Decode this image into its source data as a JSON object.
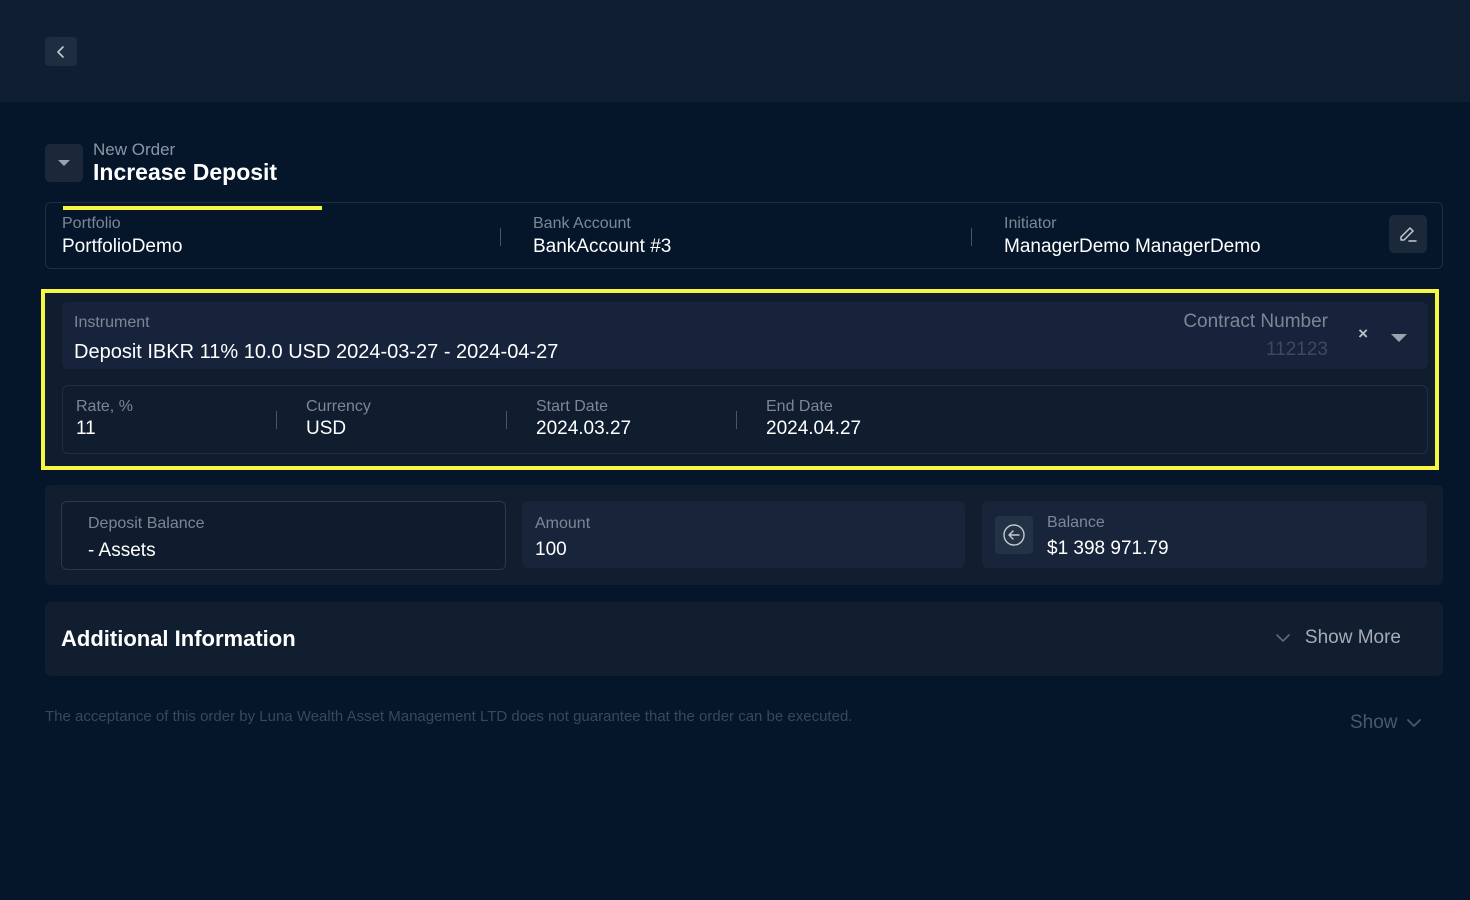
{
  "header": {
    "back_icon": "chevron-left-icon"
  },
  "order": {
    "subtitle": "New Order",
    "title": "Increase Deposit",
    "collapse_icon": "caret-down-icon"
  },
  "info": {
    "portfolio": {
      "label": "Portfolio",
      "value": "PortfolioDemo"
    },
    "bank_account": {
      "label": "Bank Account",
      "value": "BankAccount #3"
    },
    "initiator": {
      "label": "Initiator",
      "value": "ManagerDemo ManagerDemo"
    },
    "edit_icon": "pencil-icon"
  },
  "instrument": {
    "label": "Instrument",
    "value": "Deposit IBKR 11% 10.0 USD 2024-03-27 - 2024-04-27",
    "contract_label": "Contract Number",
    "contract_value": "112123",
    "clear_glyph": "×",
    "highlight_color": "#f9f545"
  },
  "details": [
    {
      "label": "Rate, %",
      "value": "11"
    },
    {
      "label": "Currency",
      "value": "USD"
    },
    {
      "label": "Start Date",
      "value": "2024.03.27"
    },
    {
      "label": "End Date",
      "value": "2024.04.27"
    }
  ],
  "amounts": {
    "deposit_balance": {
      "label": "Deposit Balance",
      "value": "- Assets"
    },
    "amount": {
      "label": "Amount",
      "value": "100"
    },
    "balance": {
      "label": "Balance",
      "value": "$1 398 971.79",
      "icon": "arrow-left-circle-icon"
    }
  },
  "additional": {
    "title": "Additional Information",
    "show_more_label": "Show More"
  },
  "footer": {
    "disclaimer": "The acceptance of this order by Luna Wealth Asset Management LTD does not guarantee that the order can be executed.",
    "show_label": "Show"
  }
}
